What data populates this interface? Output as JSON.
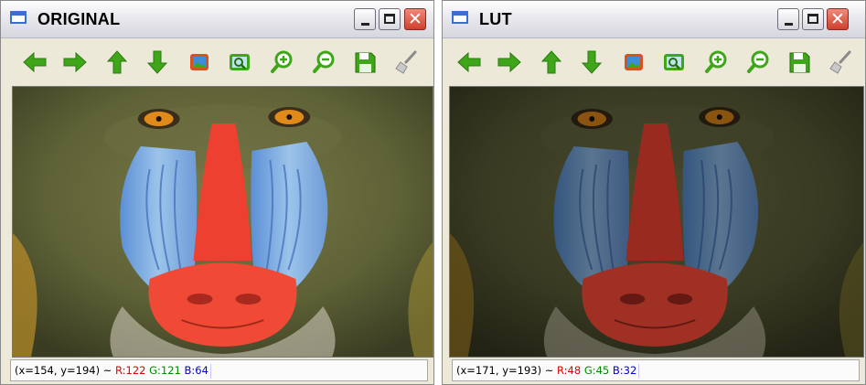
{
  "windows": [
    {
      "title": "ORIGINAL",
      "status": {
        "coords": "(x=154, y=194) ~",
        "r": "R:122",
        "g": "G:121",
        "b": "B:64"
      }
    },
    {
      "title": "LUT",
      "status": {
        "coords": "(x=171, y=193) ~",
        "r": "R:48",
        "g": "G:45",
        "b": "B:32"
      }
    }
  ],
  "toolbar_icons": [
    "arrow-left-icon",
    "arrow-right-icon",
    "arrow-up-icon",
    "arrow-down-icon",
    "image-icon",
    "zoom-fit-icon",
    "zoom-in-icon",
    "zoom-out-icon",
    "save-icon",
    "brush-icon"
  ],
  "colors": {
    "arrow_green": "#3fa61a",
    "close_red": "#d0402c",
    "status_r": "#e00000",
    "status_g": "#008a00",
    "status_b": "#0000d8"
  }
}
